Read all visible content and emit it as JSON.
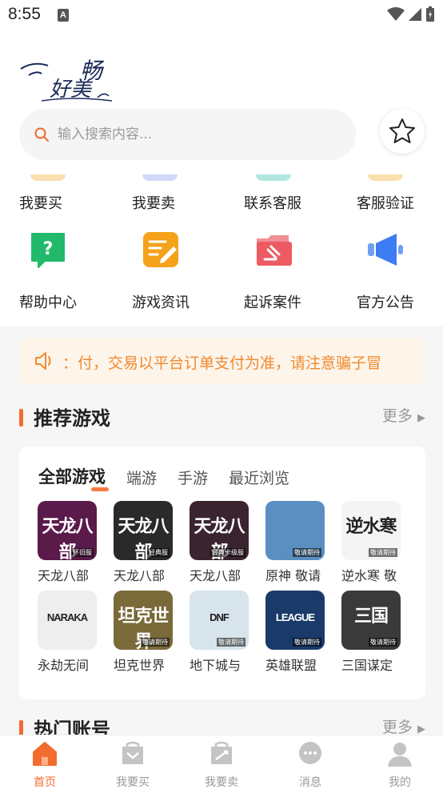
{
  "status_bar": {
    "time": "8:55"
  },
  "header": {
    "logo_text": "好美畅",
    "search_placeholder": "输入搜索内容..."
  },
  "menu": {
    "row1": [
      "我要买",
      "我要卖",
      "联系客服",
      "客服验证"
    ],
    "row2": [
      {
        "label": "帮助中心",
        "icon": "help-icon",
        "color": "#22b96a"
      },
      {
        "label": "游戏资讯",
        "icon": "news-icon",
        "color": "#f5a21a"
      },
      {
        "label": "起诉案件",
        "icon": "case-icon",
        "color": "#ee5a62"
      },
      {
        "label": "官方公告",
        "icon": "megaphone-icon",
        "color": "#3d7cf2"
      }
    ]
  },
  "notice": {
    "text": "：付，交易以平台订单支付为准，请注意骗子冒"
  },
  "recommend": {
    "title": "推荐游戏",
    "more": "更多",
    "tabs": [
      "全部游戏",
      "端游",
      "手游",
      "最近浏览"
    ],
    "games": [
      {
        "name": "天龙八部",
        "thumb": "天龙八部",
        "sub": "怀旧服",
        "bg": "#5a1a4a"
      },
      {
        "name": "天龙八部",
        "thumb": "天龙八部",
        "sub": "经典服",
        "bg": "#2a2a2a"
      },
      {
        "name": "天龙八部",
        "thumb": "天龙八部",
        "sub": "经典卡级服",
        "bg": "#3a2430"
      },
      {
        "name": "原神 敬请",
        "thumb": "",
        "sub": "敬请期待",
        "bg": "#5b8fc2"
      },
      {
        "name": "逆水寒 敬",
        "thumb": "逆水寒",
        "sub": "敬请期待",
        "bg": "#f4f4f4"
      },
      {
        "name": "永劫无间",
        "thumb": "NARAKA",
        "sub": "",
        "bg": "#eeeeee"
      },
      {
        "name": "坦克世界",
        "thumb": "坦克世界",
        "sub": "敬请期待",
        "bg": "#7a6a3a"
      },
      {
        "name": "地下城与",
        "thumb": "DNF",
        "sub": "敬请期待",
        "bg": "#d8e4ec"
      },
      {
        "name": "英雄联盟",
        "thumb": "LEAGUE",
        "sub": "敬请期待",
        "bg": "#1a3a6a"
      },
      {
        "name": "三国谋定",
        "thumb": "三国",
        "sub": "敬请期待",
        "bg": "#3a3a3a"
      }
    ]
  },
  "hot": {
    "title": "热门账号",
    "more": "更多"
  },
  "bottom_nav": [
    {
      "label": "首页",
      "icon": "home-icon",
      "active": true
    },
    {
      "label": "我要买",
      "icon": "buy-icon",
      "active": false
    },
    {
      "label": "我要卖",
      "icon": "sell-icon",
      "active": false
    },
    {
      "label": "消息",
      "icon": "message-icon",
      "active": false
    },
    {
      "label": "我的",
      "icon": "profile-icon",
      "active": false
    }
  ],
  "colors": {
    "accent": "#f26b2f",
    "notice_bg": "#fdf4ea",
    "notice_text": "#f08a2e"
  }
}
